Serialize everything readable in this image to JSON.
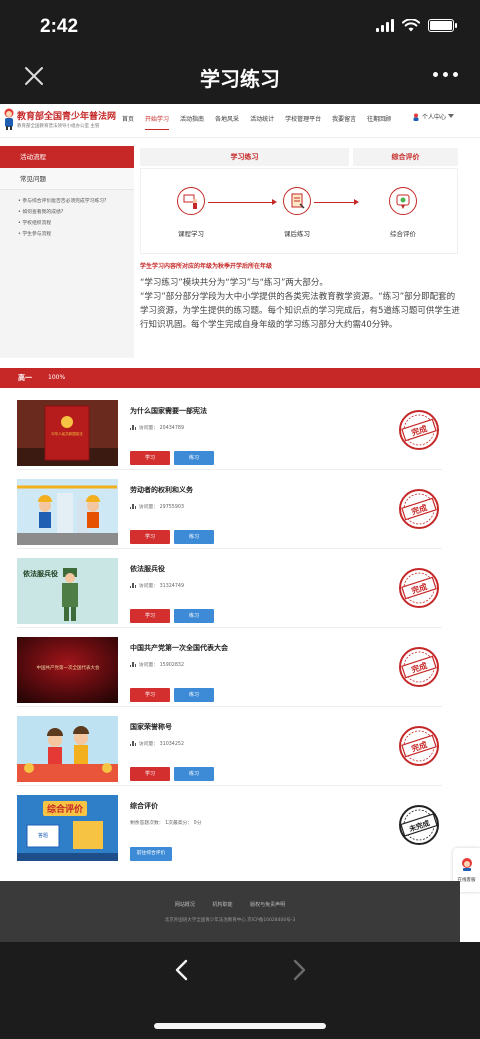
{
  "status": {
    "time": "2:42"
  },
  "nav": {
    "title": "学习练习"
  },
  "site": {
    "name": "教育部全国青少年普法网",
    "sub": "教育部全国教育普法领导小组办公室 主管",
    "menu": [
      "首页",
      "开始学习",
      "活动指南",
      "各地风采",
      "活动统计",
      "学校管理平台",
      "我要留言",
      "往期回顾"
    ],
    "user_center": "个人中心"
  },
  "sidebar": {
    "active": "活动流程",
    "item": "常见问题",
    "links": [
      "参与综合评价能否否必须完成学习练习?",
      "如何查看我的成绩?",
      "学校组织流程",
      "学生参与流程"
    ]
  },
  "steps": {
    "head_study": "学习练习",
    "head_eval": "综合评价",
    "items": [
      "课程学习",
      "课后练习",
      "综合评价"
    ]
  },
  "note_red": "学生学习内容所对应的年级为秋季开学后所在年级",
  "intro": "“学习练习”模块共分为“学习”与“练习”两大部分。\n“学习”部分部分学段为大中小学提供的各类宪法教育教学资源。“练习”部分即配套的学习资源，为学生提供的练习题。每个知识点的学习完成后，有5道练习题可供学生进行知识巩固。每个学生完成自身年级的学习练习部分大约需40分钟。",
  "grade": {
    "name": "高一",
    "progress": "100%"
  },
  "buttons": {
    "study": "学习",
    "practice": "练习"
  },
  "lessons": [
    {
      "title": "为什么国家需要一部宪法",
      "visits": "访问量： 20434789",
      "stamp": "完成"
    },
    {
      "title": "劳动者的权利和义务",
      "visits": "访问量： 29755903",
      "stamp": "完成"
    },
    {
      "title": "依法服兵役",
      "visits": "访问量： 31324749",
      "stamp": "完成"
    },
    {
      "title": "中国共产党第一次全国代表大会",
      "visits": "访问量： 15902832",
      "stamp": "完成"
    },
    {
      "title": "国家荣誉称号",
      "visits": "访问量： 31034252",
      "stamp": "完成"
    }
  ],
  "thumb_text": {
    "book": "中华人民共和国宪法",
    "soldier": "依法服兵役",
    "congress": "中国共产党第一次全国代表大会",
    "eval_banner": "综合评价",
    "eval_screen": "答题"
  },
  "evaluation": {
    "title": "综合评价",
    "remaining": "剩余答题次数： 1次最高分： 0分",
    "button": "前往综合评价",
    "stamp": "未完成"
  },
  "float_service": "在线客服",
  "footer": {
    "links": [
      "网站概况",
      "机构职能",
      "版权与免责声明"
    ],
    "copy": "北京外国语大学全国青少年法治教育中心 京ICP备10028400号-3"
  },
  "colors": {
    "brand_red": "#c62828",
    "button_blue": "#3d8bd6",
    "done_stamp": "#c62828",
    "undone_stamp": "#222222"
  }
}
